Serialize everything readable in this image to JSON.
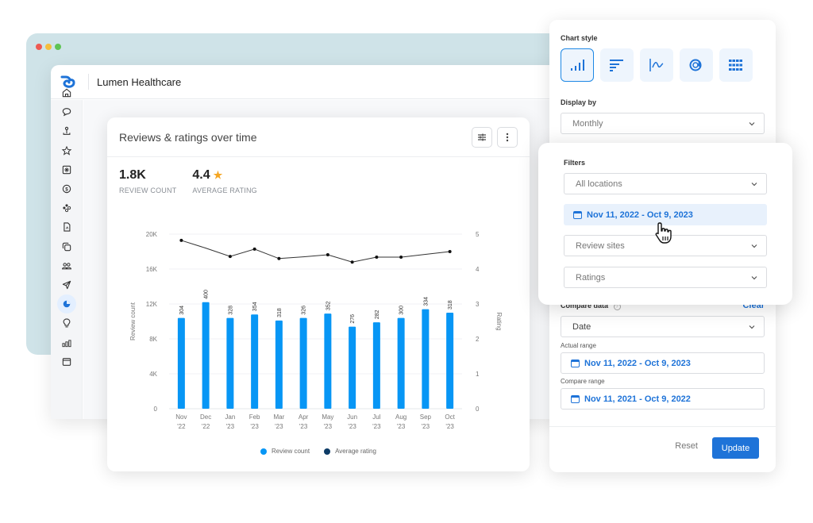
{
  "window": {
    "traffic_lights": [
      "#ee5a52",
      "#f5be3d",
      "#5fc454"
    ],
    "app_title": "Lumen Healthcare",
    "brand_color": "#1e73d8"
  },
  "sidebar": {
    "items": [
      {
        "icon": "home-icon",
        "active": false
      },
      {
        "icon": "chat-bubble-icon",
        "active": false
      },
      {
        "icon": "location-pin-icon",
        "active": false
      },
      {
        "icon": "star-icon",
        "active": false
      },
      {
        "icon": "grid-snowflake-icon",
        "active": false
      },
      {
        "icon": "dollar-icon",
        "active": false
      },
      {
        "icon": "integrations-icon",
        "active": false
      },
      {
        "icon": "document-icon",
        "active": false
      },
      {
        "icon": "copy-icon",
        "active": false
      },
      {
        "icon": "users-icon",
        "active": false
      },
      {
        "icon": "send-icon",
        "active": false
      },
      {
        "icon": "pie-chart-icon",
        "active": true
      },
      {
        "icon": "lightbulb-icon",
        "active": false
      },
      {
        "icon": "bar-chart-icon",
        "active": false
      },
      {
        "icon": "calendar-window-icon",
        "active": false
      }
    ]
  },
  "card": {
    "title": "Reviews & ratings over time",
    "stats": [
      {
        "value": "1.8K",
        "label": "REVIEW COUNT"
      },
      {
        "value": "4.4",
        "label": "AVERAGE RATING",
        "star": "★"
      }
    ],
    "legend": [
      {
        "label": "Review count",
        "color": "#0796f5"
      },
      {
        "label": "Average rating",
        "color": "#0d3b66"
      }
    ]
  },
  "chart_data": {
    "type": "bar",
    "title": "Reviews & ratings over time",
    "categories": [
      "Nov '22",
      "Dec '22",
      "Jan '23",
      "Feb '23",
      "Mar '23",
      "Apr '23",
      "May '23",
      "Jun '23",
      "Jul '23",
      "Aug '23",
      "Sep '23",
      "Oct '23"
    ],
    "category_lines": [
      [
        "Nov",
        "'22"
      ],
      [
        "Dec",
        "'22"
      ],
      [
        "Jan",
        "'23"
      ],
      [
        "Feb",
        "'23"
      ],
      [
        "Mar",
        "'23"
      ],
      [
        "Apr",
        "'23"
      ],
      [
        "May",
        "'23"
      ],
      [
        "Jun",
        "'23"
      ],
      [
        "Jul",
        "'23"
      ],
      [
        "Aug",
        "'23"
      ],
      [
        "Sep",
        "'23"
      ],
      [
        "Oct",
        "'23"
      ]
    ],
    "series": [
      {
        "name": "Review count",
        "type": "bar",
        "axis": "left",
        "color": "#0796f5",
        "values": [
          10400,
          12200,
          10400,
          10800,
          10100,
          10400,
          10900,
          9400,
          9900,
          10400,
          11400,
          11000
        ],
        "data_labels": [
          "304",
          "400",
          "328",
          "354",
          "318",
          "326",
          "352",
          "276",
          "282",
          "300",
          "334",
          "318"
        ]
      },
      {
        "name": "Average rating",
        "type": "line",
        "axis": "right",
        "color": "#222222",
        "values": [
          4.82,
          4.6,
          4.36,
          4.57,
          4.3,
          4.35,
          4.41,
          4.2,
          4.34,
          4.34,
          4.42,
          4.5
        ],
        "markers": [
          true,
          false,
          true,
          true,
          true,
          false,
          true,
          true,
          true,
          true,
          false,
          true
        ]
      }
    ],
    "ylabel": "Review count",
    "ylabel_right": "Rating",
    "ylim": [
      0,
      20000
    ],
    "ylim_right": [
      0,
      5
    ],
    "yticks": [
      "0",
      "4K",
      "8K",
      "12K",
      "16K",
      "20K"
    ],
    "yticks_right": [
      "0",
      "1",
      "2",
      "3",
      "4",
      "5"
    ],
    "grid": true,
    "legend_position": "bottom"
  },
  "panel": {
    "chart_style_label": "Chart style",
    "chart_styles": [
      {
        "icon": "vertical-bar-chart-icon",
        "selected": true
      },
      {
        "icon": "horizontal-bar-chart-icon",
        "selected": false
      },
      {
        "icon": "line-chart-icon",
        "selected": false
      },
      {
        "icon": "donut-chart-icon",
        "selected": false
      },
      {
        "icon": "table-grid-icon",
        "selected": false
      }
    ],
    "display_by_label": "Display by",
    "display_by_value": "Monthly",
    "compare_label": "Compare data",
    "clear_label": "Clear",
    "compare_value": "Date",
    "actual_range_label": "Actual range",
    "actual_range_value": "Nov 11, 2022 - Oct 9, 2023",
    "compare_range_label": "Compare range",
    "compare_range_value": "Nov 11, 2021 - Oct 9, 2022",
    "reset_label": "Reset",
    "update_label": "Update"
  },
  "filters": {
    "title": "Filters",
    "locations_placeholder": "All locations",
    "date_range": "Nov 11, 2022 - Oct 9, 2023",
    "review_sites_placeholder": "Review sites",
    "ratings_placeholder": "Ratings"
  }
}
